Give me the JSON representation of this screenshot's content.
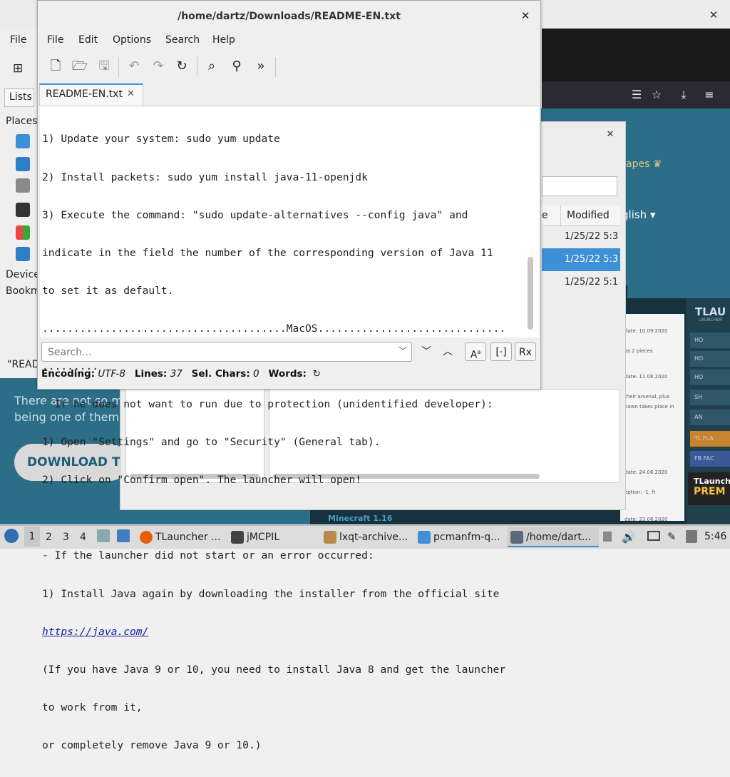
{
  "browser": {
    "close_glyph": "✕",
    "page": {
      "left_text_line1": "There are not so m",
      "left_text_line2": "being one of them",
      "download_label": "DOWNLOAD TL",
      "shapes_label": "apes ♛",
      "english_label": "glish ▾",
      "minecraft_link": "Minecraft 1.16",
      "launcher_title": "TLAU",
      "launcher_sub": "LAUNCHER",
      "launcher_rows": [
        "HO",
        "HO",
        "HO",
        "SH",
        "AN",
        "TL  FLA",
        "FB  FAC"
      ],
      "promo_line1": "TLaunch",
      "promo_line2": "PREM",
      "news": [
        {
          "text": "date: 10.09.2020"
        },
        {
          "text": "as 2 pieces."
        },
        {
          "text": "date: 11.08.2020"
        },
        {
          "text": "their arsenal, plus"
        },
        {
          "text": "pawn takes place in"
        },
        {
          "text": "date: 24.06.2020"
        },
        {
          "text": "eption: -1, ft"
        },
        {
          "text": "date: 23.06.2020"
        }
      ]
    }
  },
  "file_manager": {
    "menu_file": "File",
    "tab_lists": "Lists",
    "places": "Places",
    "devices": "Device",
    "bookmarks": "Bookm",
    "read_text": "\"READ"
  },
  "archiver": {
    "close_glyph": "✕",
    "col_e": "e",
    "col_modified": "Modified",
    "rows": [
      {
        "modified": "1/25/22 5:3"
      },
      {
        "modified": "1/25/22 5:3"
      },
      {
        "modified": "1/25/22 5:1"
      }
    ]
  },
  "editor": {
    "title": "/home/dartz/Downloads/README-EN.txt",
    "close_glyph": "✕",
    "menu": [
      "File",
      "Edit",
      "Options",
      "Search",
      "Help"
    ],
    "tab_label": "README-EN.txt",
    "tab_close": "✕",
    "lines": [
      "1) Update your system: sudo yum update",
      "2) Install packets: sudo yum install java-11-openjdk",
      "3) Execute the command: \"sudo update-alternatives --config java\" and",
      "indicate in the field the number of the corresponding version of Java 11",
      "to set it as default.",
      ".......................................MacOS..............................",
      ".........",
      "- If he does not want to run due to protection (unidentified developer):",
      "1) Open \"Settings\" and go to \"Security\" (General tab).",
      "2) Click on \"Confirm open\". The launcher will open!",
      "",
      "- If the launcher did not start or an error occurred:",
      "1) Install Java again by downloading the installer from the official site"
    ],
    "link": "https://java.com/",
    "lines_after": [
      "(If you have Java 9 or 10, you need to install Java 8 and get the launcher",
      "to work from it,",
      "or completely remove Java 9 or 10.)"
    ],
    "find_placeholder": "Search...",
    "status": {
      "encoding_label": "Encoding:",
      "encoding_value": "UTF-8",
      "lines_label": "Lines:",
      "lines_value": "37",
      "sel_label": "Sel. Chars:",
      "sel_value": "0",
      "words_label": "Words:"
    }
  },
  "taskbar": {
    "workspaces": [
      "1",
      "2",
      "3",
      "4"
    ],
    "tasks": [
      {
        "label": "TLauncher ..."
      },
      {
        "label": "jMCPIL"
      },
      {
        "label": "lxqt-archive..."
      },
      {
        "label": "pcmanfm-q..."
      },
      {
        "label": "/home/dart..."
      }
    ],
    "clock": "5:46"
  },
  "colors": {
    "accent": "#3d8fd6",
    "page_teal": "#2c6d87",
    "link": "#1a1aa6"
  }
}
